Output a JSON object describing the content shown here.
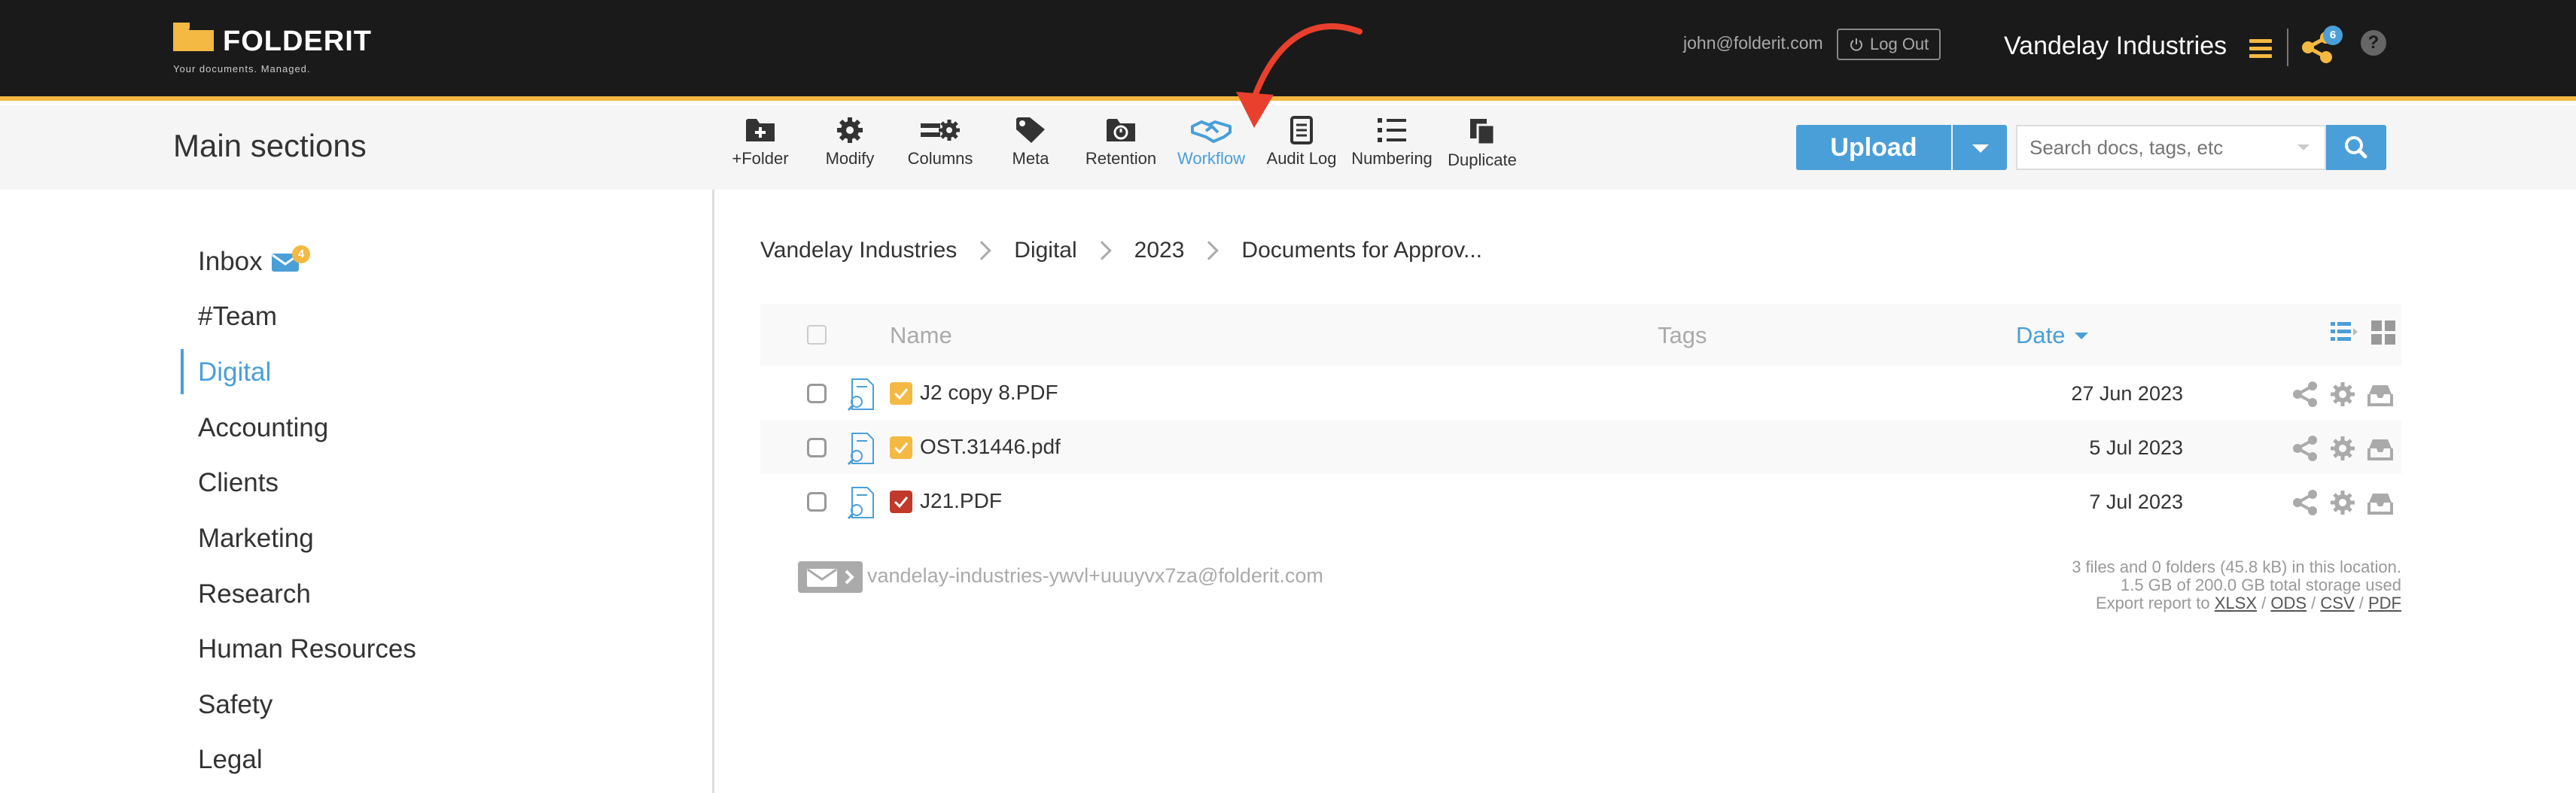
{
  "app": {
    "name": "FOLDERIT",
    "tagline": "Your documents. Managed."
  },
  "header": {
    "user_email": "john@folderit.com",
    "logout_label": "Log Out",
    "org_name": "Vandelay Industries",
    "share_count": "6",
    "help_label": "?"
  },
  "toolbar": {
    "title": "Main sections",
    "tools": [
      {
        "label": "+Folder",
        "icon": "add-folder-icon"
      },
      {
        "label": "Modify",
        "icon": "gear-icon"
      },
      {
        "label": "Columns",
        "icon": "columns-icon"
      },
      {
        "label": "Meta",
        "icon": "tag-icon"
      },
      {
        "label": "Retention",
        "icon": "retention-folder-icon"
      },
      {
        "label": "Workflow",
        "icon": "handshake-icon",
        "active": true
      },
      {
        "label": "Audit Log",
        "icon": "document-icon"
      },
      {
        "label": "Numbering",
        "icon": "numbered-list-icon"
      },
      {
        "label": "Duplicate",
        "icon": "copy-icon"
      }
    ],
    "upload_label": "Upload",
    "search_placeholder": "Search docs, tags, etc"
  },
  "sidebar": {
    "items": [
      {
        "label": "Inbox",
        "badge": "4"
      },
      {
        "label": "#Team"
      },
      {
        "label": "Digital",
        "active": true
      },
      {
        "label": "Accounting"
      },
      {
        "label": "Clients"
      },
      {
        "label": "Marketing"
      },
      {
        "label": "Research"
      },
      {
        "label": "Human Resources"
      },
      {
        "label": "Safety"
      },
      {
        "label": "Legal"
      }
    ]
  },
  "breadcrumb": [
    "Vandelay Industries",
    "Digital",
    "2023",
    "Documents for Approv..."
  ],
  "table": {
    "headers": {
      "name": "Name",
      "tags": "Tags",
      "date": "Date"
    },
    "rows": [
      {
        "name": "J2 copy 8.PDF",
        "date": "27 Jun 2023",
        "status_color": "#f4b942"
      },
      {
        "name": "OST.31446.pdf",
        "date": "5 Jul 2023",
        "status_color": "#f4b942"
      },
      {
        "name": "J21.PDF",
        "date": "7 Jul 2023",
        "status_color": "#c0392b"
      }
    ]
  },
  "footer": {
    "email_address": "vandelay-industries-ywvl+uuuyvx7za@folderit.com",
    "summary_line1": "3 files and 0 folders (45.8 kB) in this location.",
    "summary_line2": "1.5 GB of 200.0 GB total storage used",
    "export_prefix": "Export report to",
    "export_formats": [
      "XLSX",
      "ODS",
      "CSV",
      "PDF"
    ]
  },
  "colors": {
    "accent": "#4a9fd8",
    "brand": "#f4b942",
    "topbar": "#1a1a1a"
  }
}
